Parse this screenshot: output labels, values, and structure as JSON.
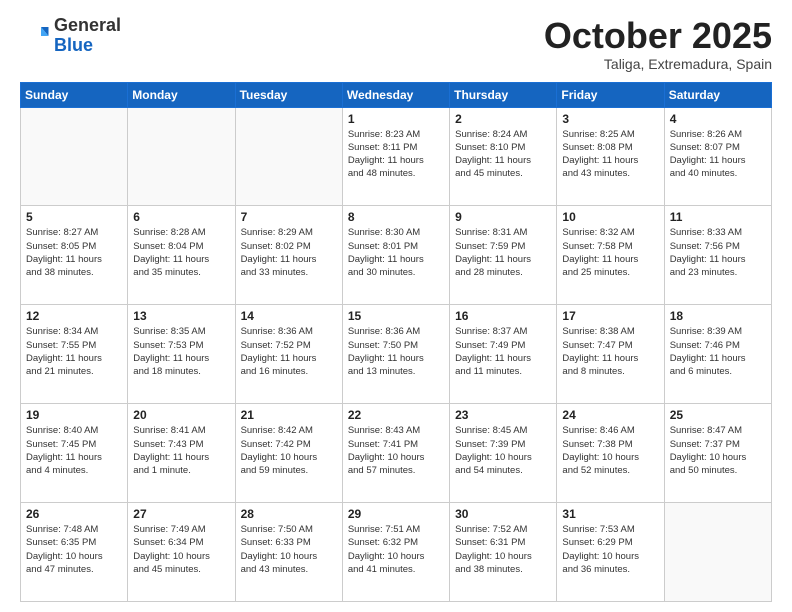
{
  "logo": {
    "general": "General",
    "blue": "Blue"
  },
  "title": "October 2025",
  "subtitle": "Taliga, Extremadura, Spain",
  "headers": [
    "Sunday",
    "Monday",
    "Tuesday",
    "Wednesday",
    "Thursday",
    "Friday",
    "Saturday"
  ],
  "weeks": [
    [
      {
        "day": "",
        "info": ""
      },
      {
        "day": "",
        "info": ""
      },
      {
        "day": "",
        "info": ""
      },
      {
        "day": "1",
        "info": "Sunrise: 8:23 AM\nSunset: 8:11 PM\nDaylight: 11 hours\nand 48 minutes."
      },
      {
        "day": "2",
        "info": "Sunrise: 8:24 AM\nSunset: 8:10 PM\nDaylight: 11 hours\nand 45 minutes."
      },
      {
        "day": "3",
        "info": "Sunrise: 8:25 AM\nSunset: 8:08 PM\nDaylight: 11 hours\nand 43 minutes."
      },
      {
        "day": "4",
        "info": "Sunrise: 8:26 AM\nSunset: 8:07 PM\nDaylight: 11 hours\nand 40 minutes."
      }
    ],
    [
      {
        "day": "5",
        "info": "Sunrise: 8:27 AM\nSunset: 8:05 PM\nDaylight: 11 hours\nand 38 minutes."
      },
      {
        "day": "6",
        "info": "Sunrise: 8:28 AM\nSunset: 8:04 PM\nDaylight: 11 hours\nand 35 minutes."
      },
      {
        "day": "7",
        "info": "Sunrise: 8:29 AM\nSunset: 8:02 PM\nDaylight: 11 hours\nand 33 minutes."
      },
      {
        "day": "8",
        "info": "Sunrise: 8:30 AM\nSunset: 8:01 PM\nDaylight: 11 hours\nand 30 minutes."
      },
      {
        "day": "9",
        "info": "Sunrise: 8:31 AM\nSunset: 7:59 PM\nDaylight: 11 hours\nand 28 minutes."
      },
      {
        "day": "10",
        "info": "Sunrise: 8:32 AM\nSunset: 7:58 PM\nDaylight: 11 hours\nand 25 minutes."
      },
      {
        "day": "11",
        "info": "Sunrise: 8:33 AM\nSunset: 7:56 PM\nDaylight: 11 hours\nand 23 minutes."
      }
    ],
    [
      {
        "day": "12",
        "info": "Sunrise: 8:34 AM\nSunset: 7:55 PM\nDaylight: 11 hours\nand 21 minutes."
      },
      {
        "day": "13",
        "info": "Sunrise: 8:35 AM\nSunset: 7:53 PM\nDaylight: 11 hours\nand 18 minutes."
      },
      {
        "day": "14",
        "info": "Sunrise: 8:36 AM\nSunset: 7:52 PM\nDaylight: 11 hours\nand 16 minutes."
      },
      {
        "day": "15",
        "info": "Sunrise: 8:36 AM\nSunset: 7:50 PM\nDaylight: 11 hours\nand 13 minutes."
      },
      {
        "day": "16",
        "info": "Sunrise: 8:37 AM\nSunset: 7:49 PM\nDaylight: 11 hours\nand 11 minutes."
      },
      {
        "day": "17",
        "info": "Sunrise: 8:38 AM\nSunset: 7:47 PM\nDaylight: 11 hours\nand 8 minutes."
      },
      {
        "day": "18",
        "info": "Sunrise: 8:39 AM\nSunset: 7:46 PM\nDaylight: 11 hours\nand 6 minutes."
      }
    ],
    [
      {
        "day": "19",
        "info": "Sunrise: 8:40 AM\nSunset: 7:45 PM\nDaylight: 11 hours\nand 4 minutes."
      },
      {
        "day": "20",
        "info": "Sunrise: 8:41 AM\nSunset: 7:43 PM\nDaylight: 11 hours\nand 1 minute."
      },
      {
        "day": "21",
        "info": "Sunrise: 8:42 AM\nSunset: 7:42 PM\nDaylight: 10 hours\nand 59 minutes."
      },
      {
        "day": "22",
        "info": "Sunrise: 8:43 AM\nSunset: 7:41 PM\nDaylight: 10 hours\nand 57 minutes."
      },
      {
        "day": "23",
        "info": "Sunrise: 8:45 AM\nSunset: 7:39 PM\nDaylight: 10 hours\nand 54 minutes."
      },
      {
        "day": "24",
        "info": "Sunrise: 8:46 AM\nSunset: 7:38 PM\nDaylight: 10 hours\nand 52 minutes."
      },
      {
        "day": "25",
        "info": "Sunrise: 8:47 AM\nSunset: 7:37 PM\nDaylight: 10 hours\nand 50 minutes."
      }
    ],
    [
      {
        "day": "26",
        "info": "Sunrise: 7:48 AM\nSunset: 6:35 PM\nDaylight: 10 hours\nand 47 minutes."
      },
      {
        "day": "27",
        "info": "Sunrise: 7:49 AM\nSunset: 6:34 PM\nDaylight: 10 hours\nand 45 minutes."
      },
      {
        "day": "28",
        "info": "Sunrise: 7:50 AM\nSunset: 6:33 PM\nDaylight: 10 hours\nand 43 minutes."
      },
      {
        "day": "29",
        "info": "Sunrise: 7:51 AM\nSunset: 6:32 PM\nDaylight: 10 hours\nand 41 minutes."
      },
      {
        "day": "30",
        "info": "Sunrise: 7:52 AM\nSunset: 6:31 PM\nDaylight: 10 hours\nand 38 minutes."
      },
      {
        "day": "31",
        "info": "Sunrise: 7:53 AM\nSunset: 6:29 PM\nDaylight: 10 hours\nand 36 minutes."
      },
      {
        "day": "",
        "info": ""
      }
    ]
  ]
}
